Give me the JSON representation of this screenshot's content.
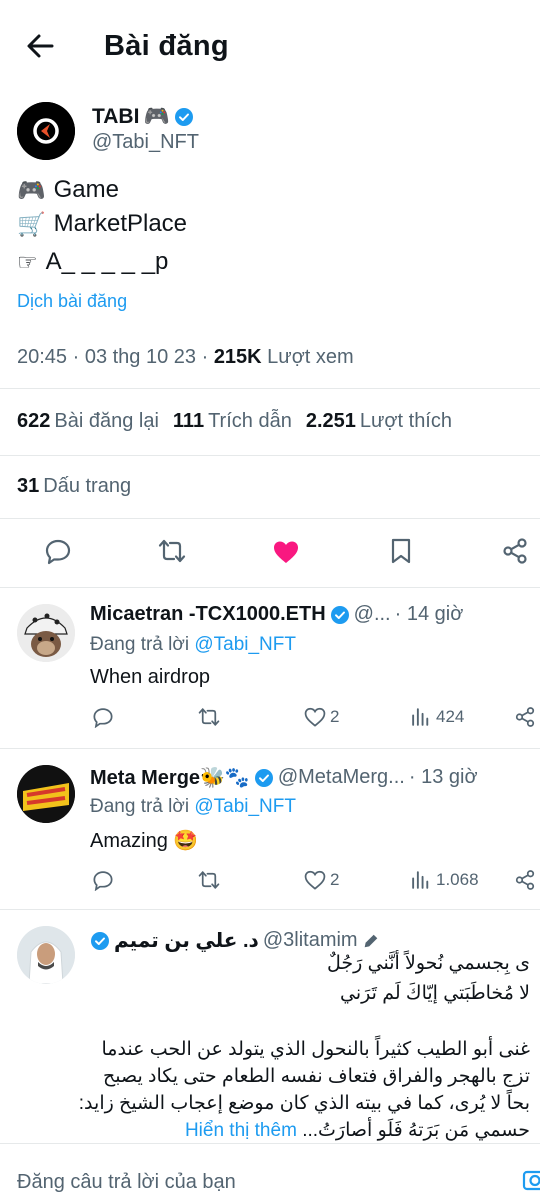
{
  "header": {
    "title": "Bài đăng"
  },
  "post": {
    "author_name": "TABI",
    "author_emoji": "🎮",
    "author_handle": "@Tabi_NFT",
    "lines": [
      {
        "icon": "🎮",
        "text": "Game"
      },
      {
        "icon": "🛒",
        "text": "MarketPlace"
      },
      {
        "icon": "☞",
        "text": "A_ _ _ _ _p"
      }
    ],
    "translate": "Dịch bài đăng",
    "time": "20:45 · 03 thg 10 23 · ",
    "views_count": "215K",
    "views_label": " Lượt xem",
    "reposts_count": "622",
    "reposts_label": "Bài đăng lại",
    "quotes_count": "111",
    "quotes_label": "Trích dẫn",
    "likes_count": "2.251",
    "likes_label": "Lượt thích",
    "bookmarks_count": "31",
    "bookmarks_label": "Dấu trang",
    "like_color": "#f91880"
  },
  "replies": [
    {
      "name": "Micaetran -TCX1000.ETH",
      "handle": "@...",
      "time": "· 14 giờ",
      "replying_prefix": "Đang trả lời ",
      "replying_to": "@Tabi_NFT",
      "text": "When airdrop",
      "likes": "2",
      "views": "424"
    },
    {
      "name": "Meta Merge🐝🐾",
      "handle": "@MetaMerg...",
      "time": "· 13 giờ",
      "replying_prefix": "Đang trả lời ",
      "replying_to": "@Tabi_NFT",
      "text": "Amazing 🤩",
      "likes": "2",
      "views": "1.068"
    },
    {
      "name": "د. علي بن تميم",
      "handle": "@3litamim",
      "lines": [
        "ى بِجسمي نُحولاً أنَّني رَجُلٌ",
        "لا مُخاطَبَتي إيّاكَ لَم تَرَني",
        "غنى أبو الطيب كثيراً بالنحول الذي يتولد عن الحب عندما",
        "تزج بالهجر والفراق فتعاف نفسه الطعام حتى يكاد يصبح",
        "بحاً لا يُرى، كما في بيته الذي كان موضع إعجاب الشيخ زايد:",
        "حسمي مَن بَرَتهُ فَلَو أصارَتُ..."
      ],
      "show_more": "Hiển thị thêm"
    }
  ],
  "compose": {
    "placeholder": "Đăng câu trả lời của bạn"
  },
  "colors": {
    "accent": "#1d9bf0",
    "text": "#0f1419",
    "muted": "#536471"
  }
}
